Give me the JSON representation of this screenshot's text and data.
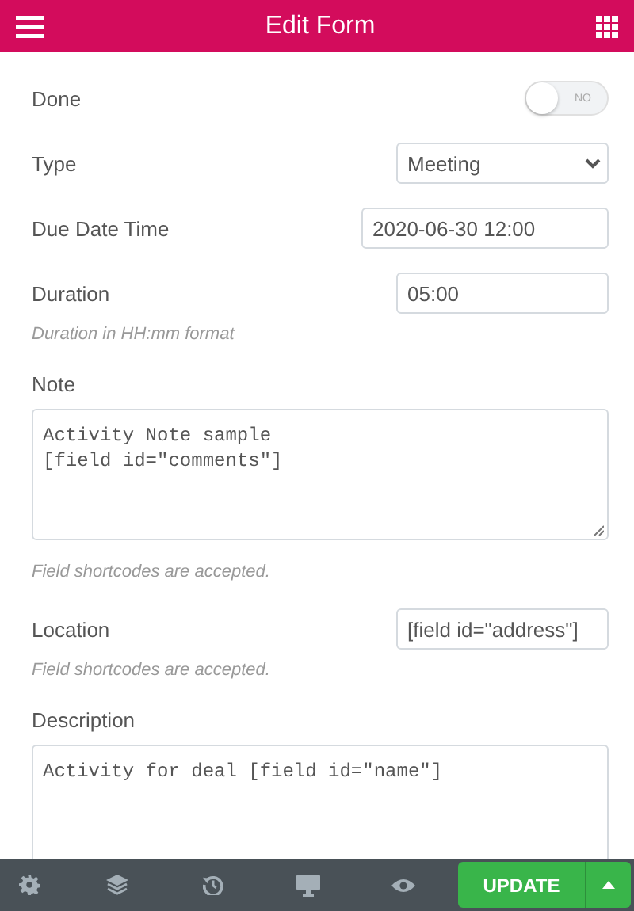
{
  "header": {
    "title": "Edit Form"
  },
  "fields": [
    {
      "kind": "toggle",
      "label": "Done",
      "on": false,
      "toggle_text": "NO"
    },
    {
      "kind": "select",
      "label": "Type",
      "value": "Meeting"
    },
    {
      "kind": "datetime",
      "label": "Due Date Time",
      "value": "2020-06-30 12:00"
    },
    {
      "kind": "text",
      "label": "Duration",
      "value": "05:00"
    },
    {
      "kind": "hint",
      "text": "Duration in HH:mm format"
    },
    {
      "kind": "textarea",
      "label": "Note",
      "value": "Activity Note sample\n[field id=\"comments\"]"
    },
    {
      "kind": "hint",
      "text": "Field shortcodes are accepted."
    },
    {
      "kind": "text",
      "label": "Location",
      "value": "[field id=\"address\"]"
    },
    {
      "kind": "hint",
      "text": "Field shortcodes are accepted."
    },
    {
      "kind": "textarea",
      "label": "Description",
      "value": "Activity for deal [field id=\"name\"]"
    }
  ],
  "footer": {
    "update_button": "UPDATE"
  }
}
